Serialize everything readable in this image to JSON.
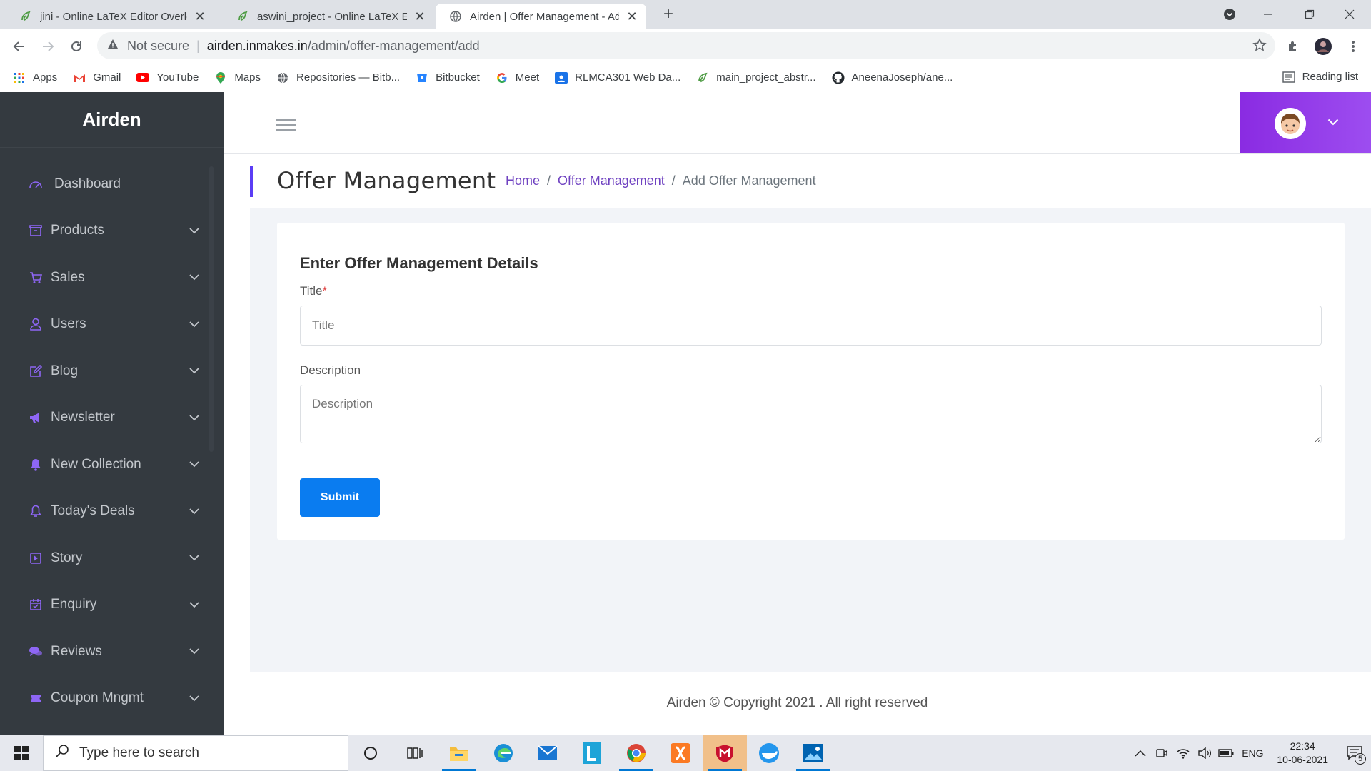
{
  "browser": {
    "tabs": [
      {
        "title": "jini - Online LaTeX Editor Overleaf",
        "icon": "overleaf-icon"
      },
      {
        "title": "aswini_project - Online LaTeX Editor",
        "icon": "overleaf-icon"
      },
      {
        "title": "Airden | Offer Management - Add",
        "icon": "globe-icon"
      }
    ],
    "address": {
      "not_secure": "Not secure",
      "host": "airden.inmakes.in",
      "path": "/admin/offer-management/add"
    },
    "bookmarks": [
      "Apps",
      "Gmail",
      "YouTube",
      "Maps",
      "Repositories — Bitb...",
      "Bitbucket",
      "Meet",
      "RLMCA301 Web Da...",
      "main_project_abstr...",
      "AneenaJoseph/ane..."
    ],
    "reading_list": "Reading list"
  },
  "app": {
    "brand": "Airden",
    "accent_color": "#8a2be2",
    "menu": [
      {
        "label": "Dashboard",
        "icon": "dashboard-icon",
        "has_children": false
      },
      {
        "label": "Products",
        "icon": "box-icon",
        "has_children": true
      },
      {
        "label": "Sales",
        "icon": "cart-icon",
        "has_children": true
      },
      {
        "label": "Users",
        "icon": "user-icon",
        "has_children": true
      },
      {
        "label": "Blog",
        "icon": "edit-icon",
        "has_children": true
      },
      {
        "label": "Newsletter",
        "icon": "megaphone-icon",
        "has_children": true
      },
      {
        "label": "New Collection",
        "icon": "bell-filled-icon",
        "has_children": true
      },
      {
        "label": "Today's Deals",
        "icon": "bell-icon",
        "has_children": true
      },
      {
        "label": "Story",
        "icon": "story-icon",
        "has_children": true
      },
      {
        "label": "Enquiry",
        "icon": "calendar-icon",
        "has_children": true
      },
      {
        "label": "Reviews",
        "icon": "comments-icon",
        "has_children": true
      },
      {
        "label": "Coupon Mngmt",
        "icon": "coupon-icon",
        "has_children": true
      }
    ],
    "page_title": "Offer Management",
    "breadcrumb": {
      "home": "Home",
      "section": "Offer Management",
      "current": "Add Offer Management",
      "separator": "/"
    },
    "form": {
      "heading": "Enter Offer Management Details",
      "title_label": "Title",
      "required_mark": "*",
      "title_placeholder": "Title",
      "title_value": "",
      "description_label": "Description",
      "description_placeholder": "Description",
      "description_value": "",
      "submit_label": "Submit"
    },
    "footer": "Airden © Copyright 2021 . All right reserved"
  },
  "taskbar": {
    "search_placeholder": "Type here to search",
    "language": "ENG",
    "time": "22:34",
    "date": "10-06-2021",
    "notification_count": "5"
  }
}
